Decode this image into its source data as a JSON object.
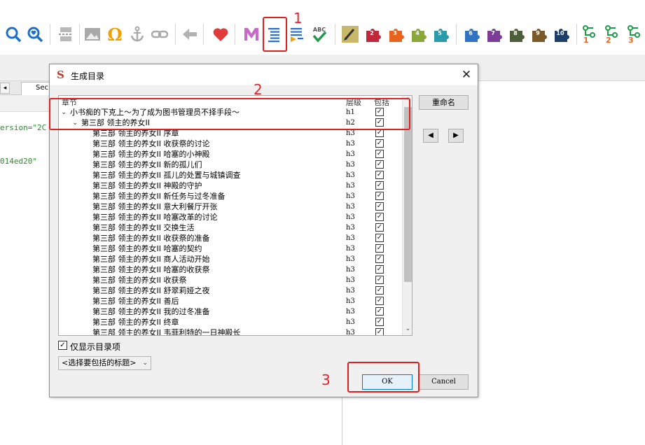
{
  "annotations": {
    "step1": "1",
    "step2": "2",
    "step3": "3"
  },
  "colors": {
    "annotation_red": "#e0242a",
    "ok_border": "#0078d7"
  },
  "toolbar": {
    "icons": [
      "magnify-icon",
      "magnify-heart-icon",
      "page-break-icon",
      "image-icon",
      "omega-icon",
      "anchor-icon",
      "link-icon",
      "arrow-left-icon",
      "heart-icon",
      "m-logo-icon",
      "toc-icon",
      "toc-add-icon",
      "spellcheck-icon",
      "edit-icon"
    ],
    "spellcheck_label": "ABC",
    "plugins": [
      "2",
      "3",
      "4",
      "5",
      "6",
      "7",
      "8",
      "9",
      "10"
    ],
    "toc_levels": [
      "1",
      "2",
      "3"
    ]
  },
  "background": {
    "tab_label": "Sec",
    "code_lines": [
      "ersion=\"2C",
      "014ed20\""
    ]
  },
  "dialog": {
    "title": "生成目录",
    "app_icon": "S",
    "close": "✕",
    "columns": {
      "chapter": "章节",
      "level": "层级",
      "include": "包括"
    },
    "rows": [
      {
        "label": "小书痴的下克上～为了成为图书管理员不择手段～",
        "level": "h1",
        "checked": "✓",
        "expander": "⌄"
      },
      {
        "label": "第三部 领主的养女II",
        "level": "h2",
        "checked": "✓",
        "expander": "⌄"
      },
      {
        "label": "第三部 领主的养女II 序章",
        "level": "h3",
        "checked": "✓"
      },
      {
        "label": "第三部 领主的养女II 收获祭的讨论",
        "level": "h3",
        "checked": "✓"
      },
      {
        "label": "第三部 领主的养女II 哈塞的小神殿",
        "level": "h3",
        "checked": "✓"
      },
      {
        "label": "第三部 领主的养女II 新的孤儿们",
        "level": "h3",
        "checked": "✓"
      },
      {
        "label": "第三部 领主的养女II 孤儿的处置与城镇调查",
        "level": "h3",
        "checked": "✓"
      },
      {
        "label": "第三部 领主的养女II 神殿的守护",
        "level": "h3",
        "checked": "✓"
      },
      {
        "label": "第三部 领主的养女II 新任务与过冬准备",
        "level": "h3",
        "checked": "✓"
      },
      {
        "label": "第三部 领主的养女II 意大利餐厅开张",
        "level": "h3",
        "checked": "✓"
      },
      {
        "label": "第三部 领主的养女II 哈塞改革的讨论",
        "level": "h3",
        "checked": "✓"
      },
      {
        "label": "第三部 领主的养女II 交换生活",
        "level": "h3",
        "checked": "✓"
      },
      {
        "label": "第三部 领主的养女II 收获祭的准备",
        "level": "h3",
        "checked": "✓"
      },
      {
        "label": "第三部 领主的养女II 哈塞的契约",
        "level": "h3",
        "checked": "✓"
      },
      {
        "label": "第三部 领主的养女II 商人活动开始",
        "level": "h3",
        "checked": "✓"
      },
      {
        "label": "第三部 领主的养女II 哈塞的收获祭",
        "level": "h3",
        "checked": "✓"
      },
      {
        "label": "第三部 领主的养女II 收获祭",
        "level": "h3",
        "checked": "✓"
      },
      {
        "label": "第三部 领主的养女II 舒翠莉娅之夜",
        "level": "h3",
        "checked": "✓"
      },
      {
        "label": "第三部 领主的养女II 善后",
        "level": "h3",
        "checked": "✓"
      },
      {
        "label": "第三部 领主的养女II 我的过冬准备",
        "level": "h3",
        "checked": "✓"
      },
      {
        "label": "第三部 领主的养女II 终章",
        "level": "h3",
        "checked": "✓"
      },
      {
        "label": "第三部 领主的养女II 韦菲利特的一日神殿长",
        "level": "h3",
        "checked": "✓"
      }
    ],
    "scroll_up": "⌃",
    "scroll_down": "⌄",
    "rename_button": "重命名",
    "move_left": "◀",
    "move_right": "▶",
    "only_show_toc_label": "仅显示目录项",
    "only_show_toc_checked": "✓",
    "heading_select": "<选择要包括的标题>",
    "select_caret": "⌄",
    "ok_button": "OK",
    "cancel_button": "Cancel"
  }
}
